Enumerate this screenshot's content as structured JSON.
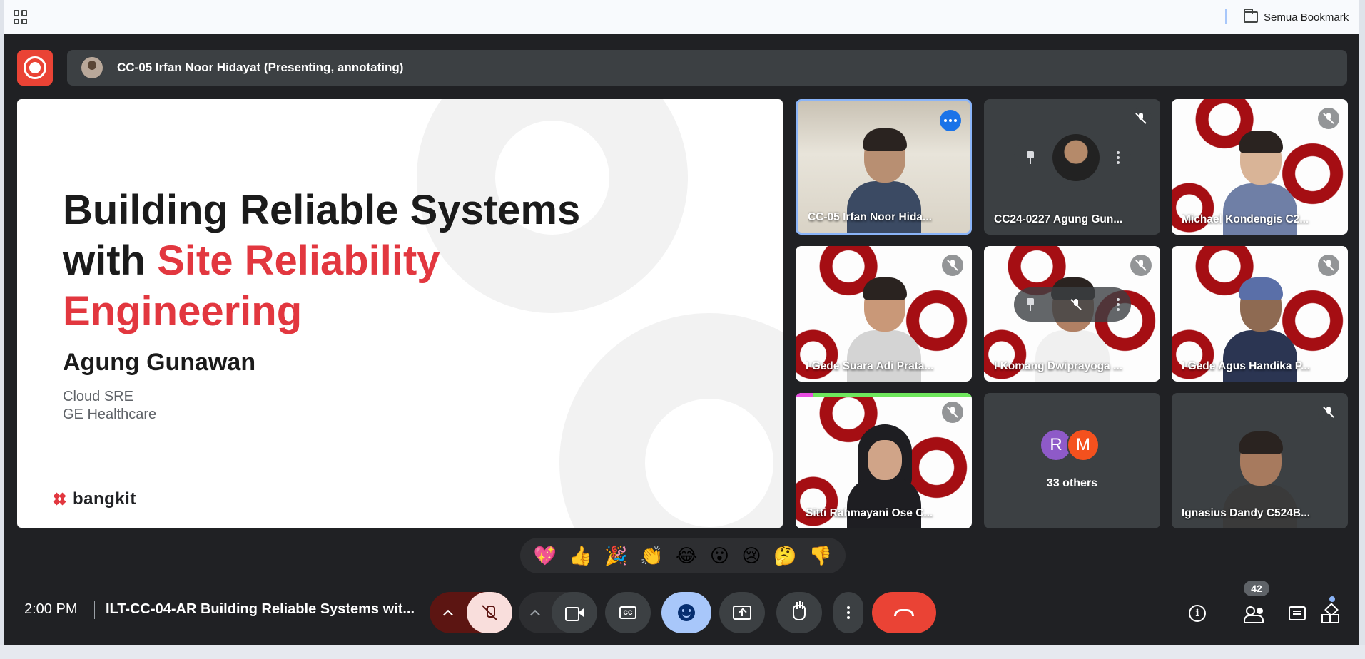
{
  "browser": {
    "bookmarks_label": "Semua Bookmark"
  },
  "header": {
    "presenter_label": "CC-05 Irfan Noor Hidayat (Presenting, annotating)"
  },
  "slide": {
    "title_line1": "Building Reliable Systems",
    "title_line2_prefix": "with ",
    "title_line2_accent": "Site Reliability",
    "title_line3_accent": "Engineering",
    "speaker": "Agung Gunawan",
    "role_line1": "Cloud SRE",
    "role_line2": "GE Healthcare",
    "logo_text": "bangkit",
    "accent_color": "#e2373f"
  },
  "participants": [
    {
      "name": "CC-05 Irfan Noor Hida...",
      "status": "active-speaker"
    },
    {
      "name": "CC24-0227 Agung Gun...",
      "status": "muted"
    },
    {
      "name": "Michael Kondengis C2...",
      "status": "muted"
    },
    {
      "name": "I Gede Suara Adi Prata...",
      "status": "muted"
    },
    {
      "name": "I Komang Dwiprayoga ...",
      "status": "muted"
    },
    {
      "name": "I Gede Agus Handika P...",
      "status": "muted"
    },
    {
      "name": "Sitti Rahmayani Ose C...",
      "status": "muted"
    },
    {
      "name": "Ignasius Dandy C524B...",
      "status": "muted"
    }
  ],
  "others": {
    "avatars": [
      {
        "initial": "R",
        "color": "#8e5ac8"
      },
      {
        "initial": "M",
        "color": "#f4511e"
      }
    ],
    "label": "33 others"
  },
  "reactions": [
    "💖",
    "👍",
    "🎉",
    "👏",
    "😂",
    "😮",
    "😢",
    "🤔",
    "👎"
  ],
  "bottom_bar": {
    "time": "2:00 PM",
    "meeting_name": "ILT-CC-04-AR Building Reliable Systems wit...",
    "cc_label": "CC",
    "participant_count": "42"
  },
  "icons": {
    "record": "record-icon",
    "mic_off": "mic-off-icon",
    "camera": "camera-icon",
    "captions": "captions-icon",
    "emoji": "emoji-icon",
    "present": "present-screen-icon",
    "raise_hand": "raise-hand-icon",
    "more": "more-vert-icon",
    "end_call": "end-call-icon",
    "info": "info-icon",
    "people": "people-icon",
    "chat": "chat-icon",
    "activities": "activities-icon"
  }
}
